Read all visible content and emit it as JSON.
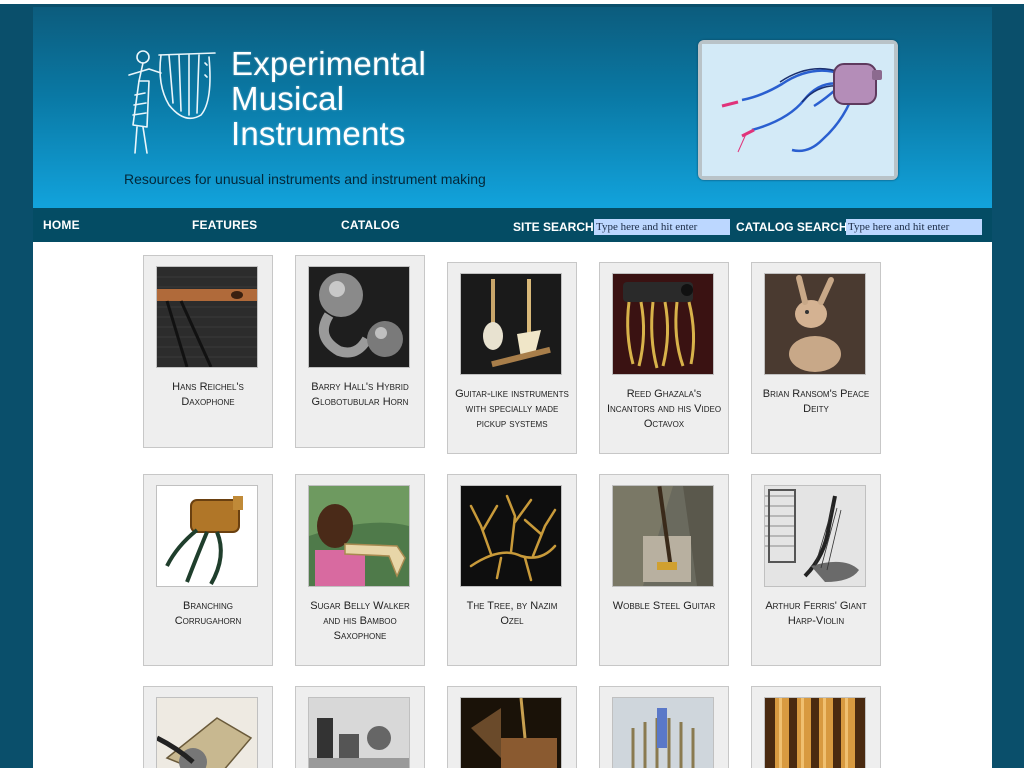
{
  "site": {
    "title_lines": [
      "Experimental",
      "Musical",
      "Instruments"
    ],
    "tagline": "Resources for unusual instruments and instrument making"
  },
  "nav": {
    "home": "HOME",
    "features": "FEATURES",
    "catalog": "CATALOG",
    "site_search_label": "SITE SEARCH:",
    "site_search_placeholder": "Type here and hit enter",
    "catalog_search_label": "CATALOG SEARCH:",
    "catalog_search_placeholder": "Type here and hit enter"
  },
  "colors": {
    "header_top": "#0c5c7d",
    "header_bottom": "#12a3dc",
    "nav_bar": "#044c64",
    "outer_background": "#0a4f6b",
    "card_background": "#eeeeee",
    "search_input_background": "#bcd7ff"
  },
  "instruments": [
    {
      "caption": "Hans Reichel's Daxophone"
    },
    {
      "caption": "Barry Hall's Hybrid Globotubular Horn"
    },
    {
      "caption": "Guitar-like instruments with specially made pickup systems"
    },
    {
      "caption": "Reed Ghazala's Incantors and his Video Octavox"
    },
    {
      "caption": "Brian Ransom's Peace Deity"
    },
    {
      "caption": "Branching Corrugahorn"
    },
    {
      "caption": "Sugar Belly Walker and his Bamboo Saxophone"
    },
    {
      "caption": "The Tree, by Nazim Ozel"
    },
    {
      "caption": "Wobble Steel Guitar"
    },
    {
      "caption": "Arthur Ferris' Giant Harp-Violin"
    },
    {
      "caption": ""
    },
    {
      "caption": ""
    },
    {
      "caption": ""
    },
    {
      "caption": ""
    },
    {
      "caption": ""
    }
  ]
}
